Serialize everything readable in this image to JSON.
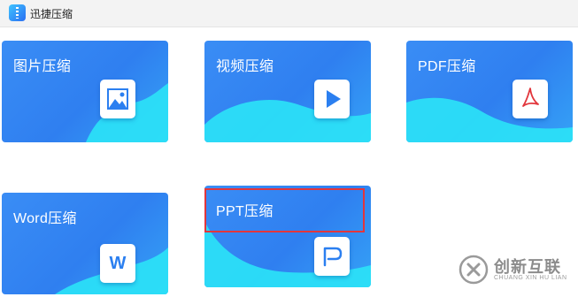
{
  "app": {
    "title": "迅捷压缩"
  },
  "cards": [
    {
      "label": "图片压缩",
      "icon": "image-icon"
    },
    {
      "label": "视频压缩",
      "icon": "play-icon"
    },
    {
      "label": "PDF压缩",
      "icon": "pdf-icon"
    },
    {
      "label": "Word压缩",
      "icon": "word-icon",
      "glyph": "W"
    },
    {
      "label": "PPT压缩",
      "icon": "ppt-icon"
    }
  ],
  "watermark": {
    "text": "创新互联",
    "subtext": "CHUANG XIN HU LIAN"
  },
  "colors": {
    "card_blue": "#2f7ff0",
    "card_cyan": "#2ae0f6",
    "highlight_red": "#e2363c"
  }
}
